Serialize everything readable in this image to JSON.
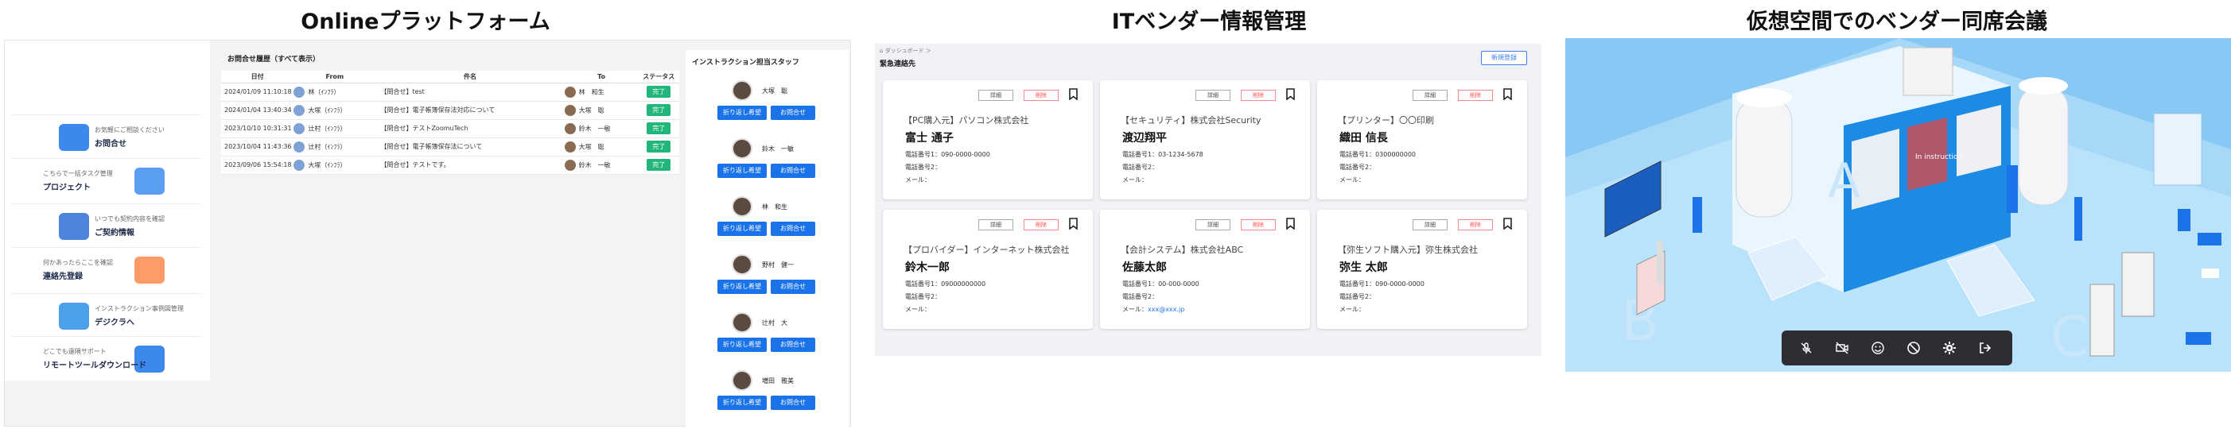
{
  "titles": {
    "panel1": "Onlineプラットフォーム",
    "panel2": "ITベンダー情報管理",
    "panel3": "仮想空間でのベンダー同席会議"
  },
  "sidebar": {
    "items": [
      {
        "sub": "お気軽にご相談ください",
        "label": "お問合せ",
        "icon": "chat-icon"
      },
      {
        "sub": "こちらで一括タスク管理",
        "label": "プロジェクト",
        "icon": "project-icon"
      },
      {
        "sub": "いつでも契約内容を確認",
        "label": "ご契約情報",
        "icon": "contract-icon"
      },
      {
        "sub": "何かあったらここを確認",
        "label": "連絡先登録",
        "icon": "contact-icon"
      },
      {
        "sub": "インストラクション事例図管理",
        "label": "デジクラへ",
        "icon": "digikura-icon"
      },
      {
        "sub": "どこでも遠隔サポート",
        "label": "リモートツールダウンロード",
        "icon": "remote-icon"
      }
    ]
  },
  "inquiries": {
    "title": "お問合せ履歴（すべて表示）",
    "headers": [
      "日付",
      "From",
      "件名",
      "To",
      "ステータス"
    ],
    "rows": [
      {
        "date": "2024/01/09 11:10:18",
        "from": "林（ｲﾝﾌﾗ）",
        "subject": "【問合せ】test",
        "to": "林　和生",
        "status": "完了"
      },
      {
        "date": "2024/01/04 13:40:34",
        "from": "大塚（ｲﾝﾌﾗ）",
        "subject": "【問合せ】電子帳簿保存法対応について",
        "to": "大塚　聡",
        "status": "完了"
      },
      {
        "date": "2023/10/10 10:31:31",
        "from": "辻村（ｲﾝﾌﾗ）",
        "subject": "【問合せ】テストZoomuTech",
        "to": "鈴木　一敏",
        "status": "完了"
      },
      {
        "date": "2023/10/04 11:43:36",
        "from": "辻村（ｲﾝﾌﾗ）",
        "subject": "【問合せ】電子帳簿保存法について",
        "to": "大塚　聡",
        "status": "完了"
      },
      {
        "date": "2023/09/06 15:54:18",
        "from": "大塚（ｲﾝﾌﾗ）",
        "subject": "【問合せ】テストです。",
        "to": "鈴木　一敏",
        "status": "完了"
      }
    ]
  },
  "staff": {
    "title": "インストラクション担当スタッフ",
    "btn_callback": "折り返し希望",
    "btn_inquiry": "お問合せ",
    "members": [
      "大塚　聡",
      "鈴木　一敏",
      "林　和生",
      "野村　健一",
      "辻村　大",
      "増田　雅美"
    ]
  },
  "vendor": {
    "breadcrumb": "ダッシュボード ＞",
    "title": "緊急連絡先",
    "new_button": "新規登録",
    "detail_label": "詳細",
    "delete_label": "削除",
    "phone1_label": "電話番号1：",
    "phone2_label": "電話番号2：",
    "mail_label": "メール：",
    "cards": [
      {
        "category": "【PC購入元】パソコン株式会社",
        "name": "富士 通子",
        "phone1": "090-0000-0000",
        "phone2": "",
        "mail": ""
      },
      {
        "category": "【セキュリティ】株式会社Security",
        "name": "渡辺翔平",
        "phone1": "03-1234-5678",
        "phone2": "",
        "mail": ""
      },
      {
        "category": "【プリンター】〇〇印刷",
        "name": "織田 信長",
        "phone1": "0300000000",
        "phone2": "",
        "mail": ""
      },
      {
        "category": "【プロバイダー】インターネット株式会社",
        "name": "鈴木一郎",
        "phone1": "09000000000",
        "phone2": "",
        "mail": ""
      },
      {
        "category": "【会計システム】株式会社ABC",
        "name": "佐藤太郎",
        "phone1": "00-000-0000",
        "phone2": "",
        "mail": "xxx@xxx.jp"
      },
      {
        "category": "【弥生ソフト購入元】弥生株式会社",
        "name": "弥生 太郎",
        "phone1": "090-0000-0000",
        "phone2": "",
        "mail": ""
      }
    ]
  },
  "virtual": {
    "banner_text": "In instruction",
    "floor_letters": [
      "A",
      "B",
      "C"
    ],
    "controls": [
      "mic-off-icon",
      "camera-off-icon",
      "emoji-icon",
      "block-icon",
      "settings-icon",
      "exit-icon"
    ]
  },
  "colors": {
    "accent": "#1a73e8",
    "done": "#23b67a",
    "delete": "#ff4d4d",
    "sky": "#87c8f4"
  }
}
